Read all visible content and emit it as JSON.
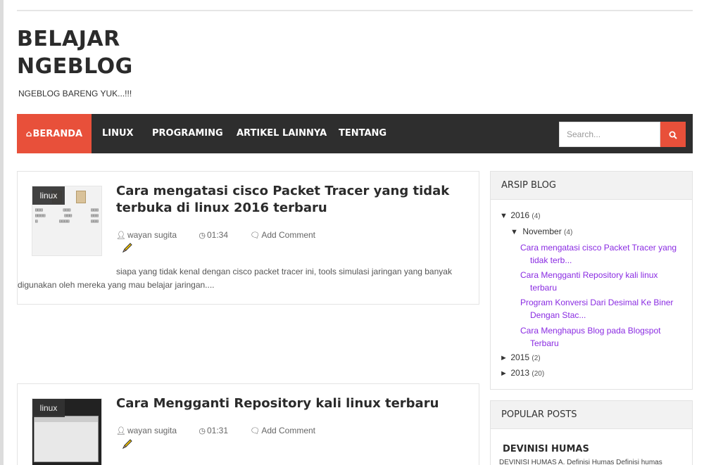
{
  "blog": {
    "title_line1": "BELAJAR",
    "title_line2": "NGEBLOG",
    "description": "NGEBLOG BARENG YUK...!!!"
  },
  "nav": {
    "items": [
      {
        "label": "BERANDA",
        "active": true
      },
      {
        "label": "LINUX"
      },
      {
        "label": "PROGRAMING"
      },
      {
        "label": "ARTIKEL LAINNYA"
      },
      {
        "label": "TENTANG"
      }
    ],
    "search_placeholder": "Search...",
    "accent_color": "#e8503a"
  },
  "posts": [
    {
      "category": "linux",
      "title": "Cara mengatasi cisco Packet Tracer yang tidak terbuka di linux 2016 terbaru",
      "author": "wayan sugita",
      "time": "01:34",
      "comment_label": "Add Comment",
      "excerpt": "siapa yang tidak kenal dengan cisco packet tracer ini, tools simulasi jaringan yang banyak digunakan oleh mereka yang mau belajar jaringan...."
    },
    {
      "category": "linux",
      "title": "Cara Mengganti Repository kali linux terbaru",
      "author": "wayan sugita",
      "time": "01:31",
      "comment_label": "Add Comment"
    }
  ],
  "archive": {
    "heading": "ARSIP BLOG",
    "years": [
      {
        "toggle": "▼",
        "year": "2016",
        "count": "(4)"
      },
      {
        "toggle": "►",
        "year": "2015",
        "count": "(2)"
      },
      {
        "toggle": "►",
        "year": "2013",
        "count": "(20)"
      }
    ],
    "month": {
      "toggle": "▼",
      "name": "November",
      "count": "(4)"
    },
    "links": [
      "Cara mengatasi cisco Packet Tracer yang tidak terb...",
      "Cara Mengganti Repository kali linux terbaru",
      "Program Konversi Dari Desimal Ke Biner Dengan Stac...",
      "Cara Menghapus Blog pada Blogspot Terbaru"
    ]
  },
  "popular": {
    "heading": "POPULAR POSTS",
    "first_title": "DEVINISI HUMAS",
    "first_snippet": "DEVINISI HUMAS A. Definisi Humas Definisi humas"
  }
}
